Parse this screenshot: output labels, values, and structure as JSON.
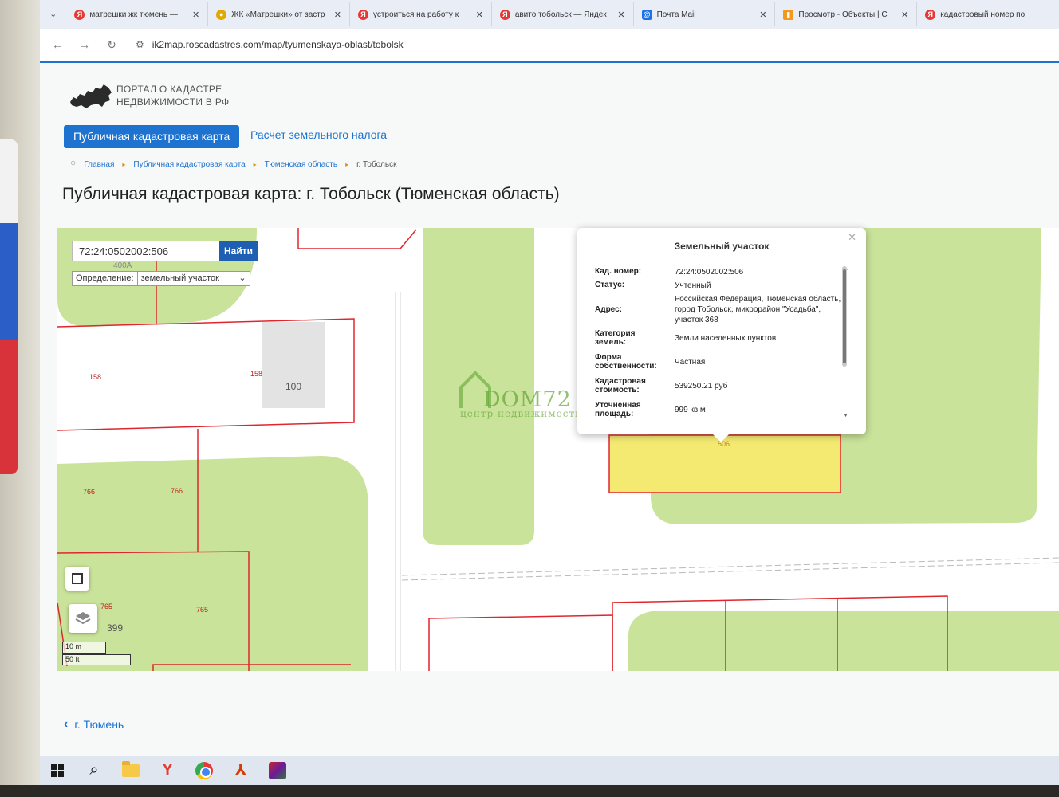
{
  "tabs": [
    {
      "title": "матрешки жк тюмень —",
      "icon": "yandex-icon"
    },
    {
      "title": "ЖК «Матрешки» от застр",
      "icon": "site-icon"
    },
    {
      "title": "устроиться на работу к",
      "icon": "yandex-icon"
    },
    {
      "title": "авито тобольск — Яндек",
      "icon": "yandex-icon"
    },
    {
      "title": "Почта Mail",
      "icon": "mail-icon"
    },
    {
      "title": "Просмотр - Объекты | С",
      "icon": "chart-icon"
    },
    {
      "title": "кадастровый номер по",
      "icon": "yandex-icon"
    }
  ],
  "address_bar": {
    "url": "ik2map.roscadastres.com/map/tyumenskaya-oblast/tobolsk"
  },
  "header": {
    "portal_title": "ПОРТАЛ О КАДАСТРЕ НЕДВИЖИМОСТИ В РФ",
    "nav_active": "Публичная кадастровая карта",
    "nav_link": "Расчет земельного налога"
  },
  "breadcrumb": [
    "Главная",
    "Публичная кадастровая карта",
    "Тюменская область",
    "г. Тобольск"
  ],
  "page_title": "Публичная кадастровая карта: г. Тобольск (Тюменская область)",
  "search": {
    "value": "72:24:0502002:506",
    "button": "Найти",
    "definition_label": "Определение:",
    "definition_value": "земельный участок"
  },
  "map_labels": {
    "l400a": "400А",
    "l158a": "158",
    "l158b": "158",
    "l100": "100",
    "l766a": "766",
    "l766b": "766",
    "l765a": "765",
    "l765b": "765",
    "l399": "399",
    "l506": "506",
    "scale_m": "10 m",
    "scale_ft": "50 ft"
  },
  "watermark": {
    "brand": "DOM72",
    "sub": "центр недвижимости"
  },
  "popup": {
    "title": "Земельный участок",
    "rows": [
      {
        "k": "Кад. номер:",
        "v": "72:24:0502002:506"
      },
      {
        "k": "Статус:",
        "v": "Учтенный"
      },
      {
        "k": "Адрес:",
        "v": "Российская Федерация, Тюменская область, город Тобольск, микрорайон \"Усадьба\", участок 368"
      },
      {
        "k": "Категория земель:",
        "v": "Земли населенных пунктов"
      },
      {
        "k": "Форма собственности:",
        "v": "Частная"
      },
      {
        "k": "Кадастровая стоимость:",
        "v": "539250.21 руб"
      },
      {
        "k": "Уточненная площадь:",
        "v": "999 кв.м"
      }
    ]
  },
  "back_link": "г. Тюмень",
  "colors": {
    "accent": "#1e73d1",
    "parcel_border": "#e0262d",
    "green_area": "#c9e39a",
    "selected_parcel": "#f4ea72"
  }
}
